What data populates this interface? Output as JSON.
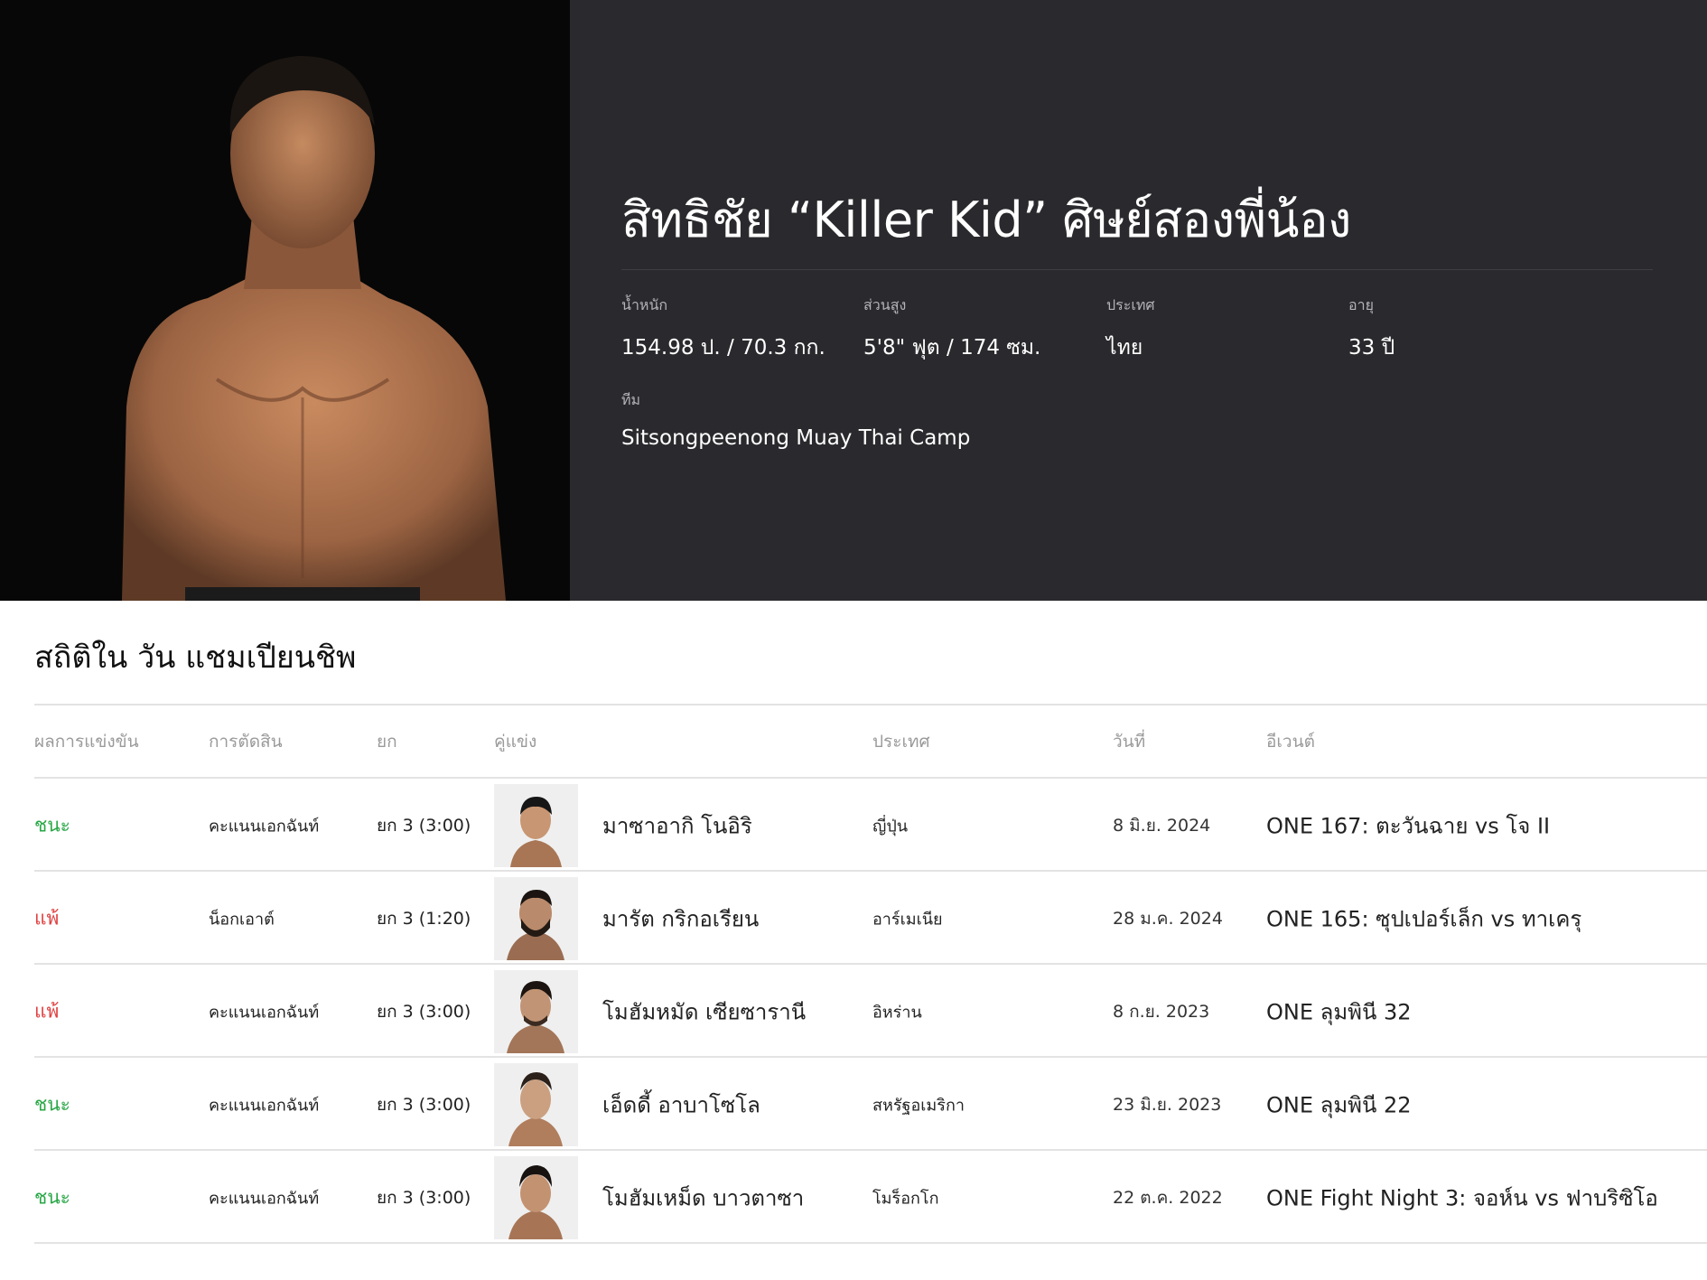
{
  "profile": {
    "name": "สิทธิชัย “Killer Kid” ศิษย์สองพี่น้อง",
    "weight_label": "น้ำหนัก",
    "weight_value": "154.98 ป. / 70.3 กก.",
    "height_label": "ส่วนสูง",
    "height_value": "5'8\" ฟุต / 174 ซม.",
    "country_label": "ประเทศ",
    "country_value": "ไทย",
    "age_label": "อายุ",
    "age_value": "33 ปี",
    "team_label": "ทีม",
    "team_value": "Sitsongpeenong Muay Thai Camp"
  },
  "stats": {
    "title": "สถิติใน วัน แชมเปียนชิพ",
    "headers": {
      "result": "ผลการแข่งขัน",
      "method": "การตัดสิน",
      "round": "ยก",
      "opponent": "คู่แข่ง",
      "country": "ประเทศ",
      "date": "วันที่",
      "event": "อีเวนต์"
    },
    "rows": [
      {
        "result": "ชนะ",
        "method": "คะแนนเอกฉันท์",
        "round": "ยก 3 (3:00)",
        "opponent": "มาซาอากิ โนอิริ",
        "country": "ญี่ปุ่น",
        "date": "8 มิ.ย. 2024",
        "event": "ONE 167: ตะวันฉาย vs โจ II"
      },
      {
        "result": "แพ้",
        "method": "น็อกเอาต์",
        "round": "ยก 3 (1:20)",
        "opponent": "มารัต กริกอเรียน",
        "country": "อาร์เมเนีย",
        "date": "28 ม.ค. 2024",
        "event": "ONE 165: ซุปเปอร์เล็ก vs ทาเครุ"
      },
      {
        "result": "แพ้",
        "method": "คะแนนเอกฉันท์",
        "round": "ยก 3 (3:00)",
        "opponent": "โมฮัมหมัด เซียซารานี",
        "country": "อิหร่าน",
        "date": "8 ก.ย. 2023",
        "event": "ONE ลุมพินี 32"
      },
      {
        "result": "ชนะ",
        "method": "คะแนนเอกฉันท์",
        "round": "ยก 3 (3:00)",
        "opponent": "เอ็ดดี้ อาบาโซโล",
        "country": "สหรัฐอเมริกา",
        "date": "23 มิ.ย. 2023",
        "event": "ONE ลุมพินี 22"
      },
      {
        "result": "ชนะ",
        "method": "คะแนนเอกฉันท์",
        "round": "ยก 3 (3:00)",
        "opponent": "โมฮัมเหม็ด บาวตาซา",
        "country": "โมร็อกโก",
        "date": "22 ต.ค. 2022",
        "event": "ONE Fight Night 3: จอห์น vs ฟาบริซิโอ"
      }
    ]
  },
  "colors": {
    "win": "#27a745",
    "loss": "#e04040",
    "hero_dark": "#2a2a2e"
  }
}
